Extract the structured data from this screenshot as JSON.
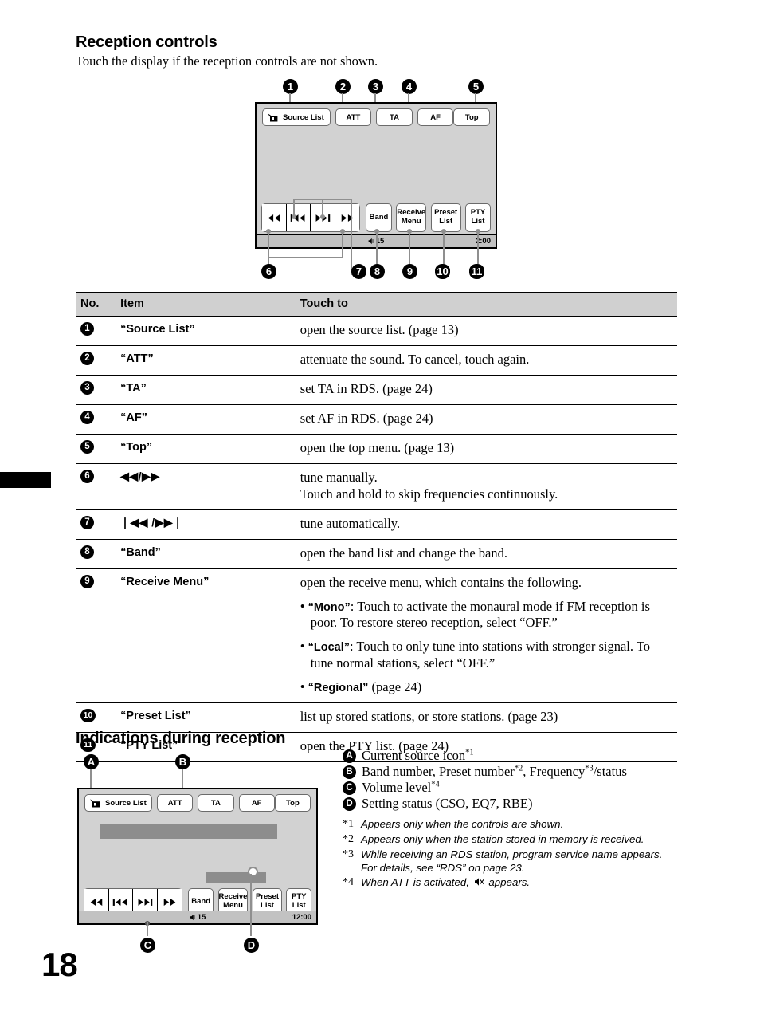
{
  "page": {
    "number": "18"
  },
  "section1": {
    "heading": "Reception controls",
    "intro": "Touch the display if the reception controls are not shown."
  },
  "device_top": {
    "top_buttons": [
      {
        "label": "Source List",
        "icon": "radio-tuner-icon"
      },
      {
        "label": "ATT"
      },
      {
        "label": "TA"
      },
      {
        "label": "AF"
      }
    ],
    "top_right_button": {
      "label": "Top"
    },
    "transport": [
      {
        "glyph": "◀◀",
        "name": "rewind"
      },
      {
        "glyph": "❘◀◀",
        "name": "seek-down"
      },
      {
        "glyph": "▶▶❘",
        "name": "seek-up"
      },
      {
        "glyph": "▶▶",
        "name": "fast-forward"
      }
    ],
    "function_buttons": [
      {
        "line1": "Band",
        "line2": ""
      },
      {
        "line1": "Receive",
        "line2": "Menu"
      },
      {
        "line1": "Preset",
        "line2": "List"
      },
      {
        "line1": "PTY",
        "line2": "List"
      }
    ],
    "status": {
      "volume": "15",
      "clock": "2:00"
    },
    "callouts_top": [
      "1",
      "2",
      "3",
      "4",
      "5"
    ],
    "callouts_bottom": [
      "6",
      "7",
      "8",
      "9",
      "10",
      "11"
    ]
  },
  "table": {
    "headers": [
      "No.",
      "Item",
      "Touch to"
    ],
    "rows": [
      {
        "no": "1",
        "item": "“Source List”",
        "item_type": "text",
        "touch": "open the source list. (page 13)"
      },
      {
        "no": "2",
        "item": "“ATT”",
        "item_type": "text",
        "touch": "attenuate the sound. To cancel, touch again."
      },
      {
        "no": "3",
        "item": "“TA”",
        "item_type": "text",
        "touch": "set TA in RDS. (page 24)"
      },
      {
        "no": "4",
        "item": "“AF”",
        "item_type": "text",
        "touch": "set AF in RDS. (page 24)"
      },
      {
        "no": "5",
        "item": "“Top”",
        "item_type": "text",
        "touch": "open the top menu. (page 13)"
      },
      {
        "no": "6",
        "item": "◀◀/▶▶",
        "item_type": "glyph",
        "touch": "tune manually.\nTouch and hold to skip frequencies continuously."
      },
      {
        "no": "7",
        "item": "❘◀◀ /▶▶❘",
        "item_type": "glyph",
        "touch": "tune automatically."
      },
      {
        "no": "8",
        "item": "“Band”",
        "item_type": "text",
        "touch": "open the band list and change the band."
      },
      {
        "no": "9",
        "item": "“Receive Menu”",
        "item_type": "text",
        "touch": "open the receive menu, which contains the following.",
        "sub_items": [
          {
            "term": "“Mono”",
            "rest": ": Touch to activate the monaural mode if FM reception is poor. To restore stereo reception, select “OFF.”"
          },
          {
            "term": "“Local”",
            "rest": ": Touch to only tune into stations with stronger signal. To tune normal stations, select “OFF.”"
          },
          {
            "term": "“Regional”",
            "rest": " (page 24)"
          }
        ]
      },
      {
        "no": "10",
        "item": "“Preset List”",
        "item_type": "text",
        "touch": "list up stored stations, or store stations. (page 23)"
      },
      {
        "no": "11",
        "item": "“PTY List”",
        "item_type": "text",
        "touch": "open the PTY list. (page 24)"
      }
    ]
  },
  "section2": {
    "heading": "Indications during reception"
  },
  "device_bottom": {
    "top_buttons": [
      {
        "label": "Source List",
        "icon": "radio-tuner-icon"
      },
      {
        "label": "ATT"
      },
      {
        "label": "TA"
      },
      {
        "label": "AF"
      }
    ],
    "top_right_button": {
      "label": "Top"
    },
    "transport": [
      {
        "glyph": "◀◀",
        "name": "rewind"
      },
      {
        "glyph": "❘◀◀",
        "name": "seek-down"
      },
      {
        "glyph": "▶▶❘",
        "name": "seek-up"
      },
      {
        "glyph": "▶▶",
        "name": "fast-forward"
      }
    ],
    "function_buttons": [
      {
        "line1": "Band",
        "line2": ""
      },
      {
        "line1": "Receive",
        "line2": "Menu"
      },
      {
        "line1": "Preset",
        "line2": "List"
      },
      {
        "line1": "PTY",
        "line2": "List"
      }
    ],
    "status": {
      "volume": "15",
      "clock": "12:00"
    },
    "callouts": [
      "A",
      "B",
      "C",
      "D"
    ]
  },
  "legend": [
    {
      "key": "A",
      "text": "Current source icon",
      "sup": "*1",
      "tail": ""
    },
    {
      "key": "B",
      "text": "Band number, Preset number",
      "sup": "*2",
      "tail": ", Frequency",
      "sup2": "*3",
      "tail2": "/status"
    },
    {
      "key": "C",
      "text": "Volume level",
      "sup": "*4",
      "tail": ""
    },
    {
      "key": "D",
      "text": "Setting status (CSO, EQ7, RBE)",
      "sup": "",
      "tail": ""
    }
  ],
  "footnotes": [
    {
      "marker": "*1",
      "text": "Appears only when the controls are shown."
    },
    {
      "marker": "*2",
      "text": "Appears only when the station stored in memory is received."
    },
    {
      "marker": "*3",
      "text": "While receiving an RDS station, program service name appears. For details, see “RDS” on page 23."
    },
    {
      "marker": "*4",
      "pre": "When ATT is activated, ",
      "icon": "att-muted-speaker-icon",
      "post": " appears."
    }
  ],
  "colors": {
    "screen_bg": "#d2d2d2",
    "infobar": "#8d8d8d",
    "statusbar": "#c2c2c2",
    "table_header": "#d0d0d0",
    "leader": "#8f8f8f"
  }
}
